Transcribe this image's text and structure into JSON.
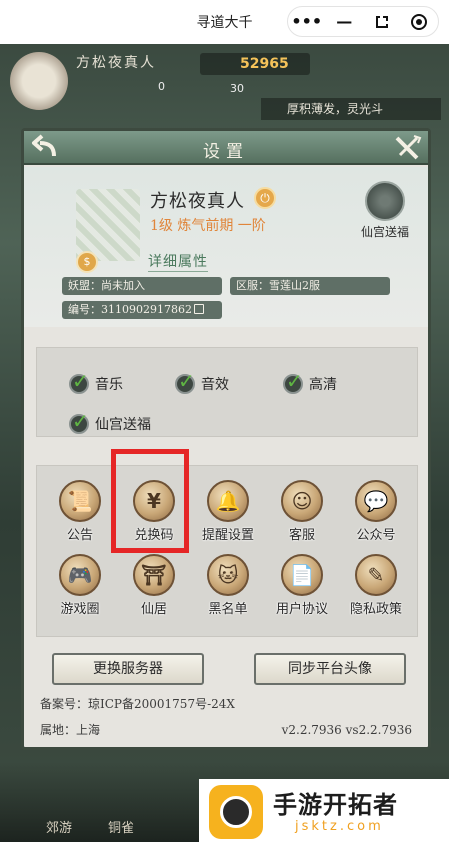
{
  "topbar": {
    "title": "寻道大千",
    "more": "•••",
    "minimize": "—"
  },
  "background": {
    "player_name": "方松夜真人",
    "power": "52965",
    "stat_a": "0",
    "stat_b": "30",
    "motto": "厚积薄发，灵光斗",
    "bottom_left": "郊游",
    "bottom_mid": "铜雀"
  },
  "settings": {
    "title": "设置",
    "profile": {
      "name": "方松夜真人",
      "rank": "1级 炼气前期 一阶",
      "detail_link": "详细属性",
      "alliance": "妖盟：尚未加入",
      "server": "区服：雪莲山2服",
      "id": "编号：3110902917862",
      "seal_label": "仙宫送福"
    },
    "toggles": [
      {
        "label": "音乐",
        "checked": true
      },
      {
        "label": "音效",
        "checked": true
      },
      {
        "label": "高清",
        "checked": true
      },
      {
        "label": "仙宫送福",
        "checked": true
      }
    ],
    "grid": [
      {
        "label": "公告",
        "icon": "scroll-icon",
        "glyph": "📜"
      },
      {
        "label": "兑换码",
        "icon": "money-bag-icon",
        "glyph": "¥"
      },
      {
        "label": "提醒设置",
        "icon": "reminder-bell-icon",
        "glyph": "🔔"
      },
      {
        "label": "客服",
        "icon": "customer-service-icon",
        "glyph": "☺"
      },
      {
        "label": "公众号",
        "icon": "wechat-icon",
        "glyph": "💬"
      },
      {
        "label": "游戏圈",
        "icon": "gamepad-icon",
        "glyph": "🎮"
      },
      {
        "label": "仙居",
        "icon": "pavilion-icon",
        "glyph": "⛩"
      },
      {
        "label": "黑名单",
        "icon": "blocked-cat-icon",
        "glyph": "🐱"
      },
      {
        "label": "用户协议",
        "icon": "agreement-icon",
        "glyph": "📄"
      },
      {
        "label": "隐私政策",
        "icon": "privacy-icon",
        "glyph": "✎"
      }
    ],
    "buttons": {
      "change_server": "更换服务器",
      "sync_avatar": "同步平台头像"
    },
    "footer": {
      "icp": "备案号：琼ICP备20001757号-24X",
      "location": "属地：上海",
      "version": "v2.2.7936 vs2.2.7936"
    }
  },
  "promo": {
    "title": "手游开拓者",
    "url": "jsktz.com"
  },
  "colors": {
    "panel_header": "#56705f",
    "highlight": "#e52626",
    "check": "#5fb543",
    "rank": "#e0853a"
  }
}
